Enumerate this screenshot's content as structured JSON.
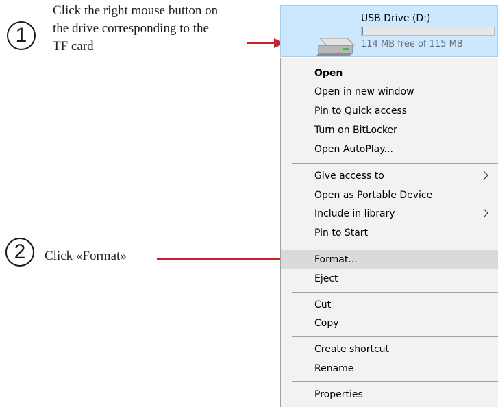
{
  "annotations": {
    "step1": {
      "number": "①",
      "lines": [
        "Click the right mouse button on",
        "the drive corresponding to the",
        "TF card"
      ]
    },
    "step2": {
      "number": "②",
      "text": "Click «Format»"
    },
    "arrow_color": "#c8202c"
  },
  "drive": {
    "name": "USB Drive (D:)",
    "free_text": "114 MB free of 115 MB",
    "used_fraction": 0.01,
    "icon": "usb-drive-icon",
    "tile_color": "#cce8ff"
  },
  "context_menu": {
    "items": [
      {
        "label": "Open",
        "bold": true
      },
      {
        "label": "Open in new window"
      },
      {
        "label": "Pin to Quick access"
      },
      {
        "label": "Turn on BitLocker"
      },
      {
        "label": "Open AutoPlay..."
      },
      {
        "label": "Give access to",
        "submenu": true
      },
      {
        "label": "Open as Portable Device"
      },
      {
        "label": "Include in library",
        "submenu": true
      },
      {
        "label": "Pin to Start"
      },
      {
        "label": "Format...",
        "highlighted": true
      },
      {
        "label": "Eject"
      },
      {
        "label": "Cut"
      },
      {
        "label": "Copy"
      },
      {
        "label": "Create shortcut"
      },
      {
        "label": "Rename"
      },
      {
        "label": "Properties"
      }
    ],
    "highlight_color": "#dadada"
  }
}
